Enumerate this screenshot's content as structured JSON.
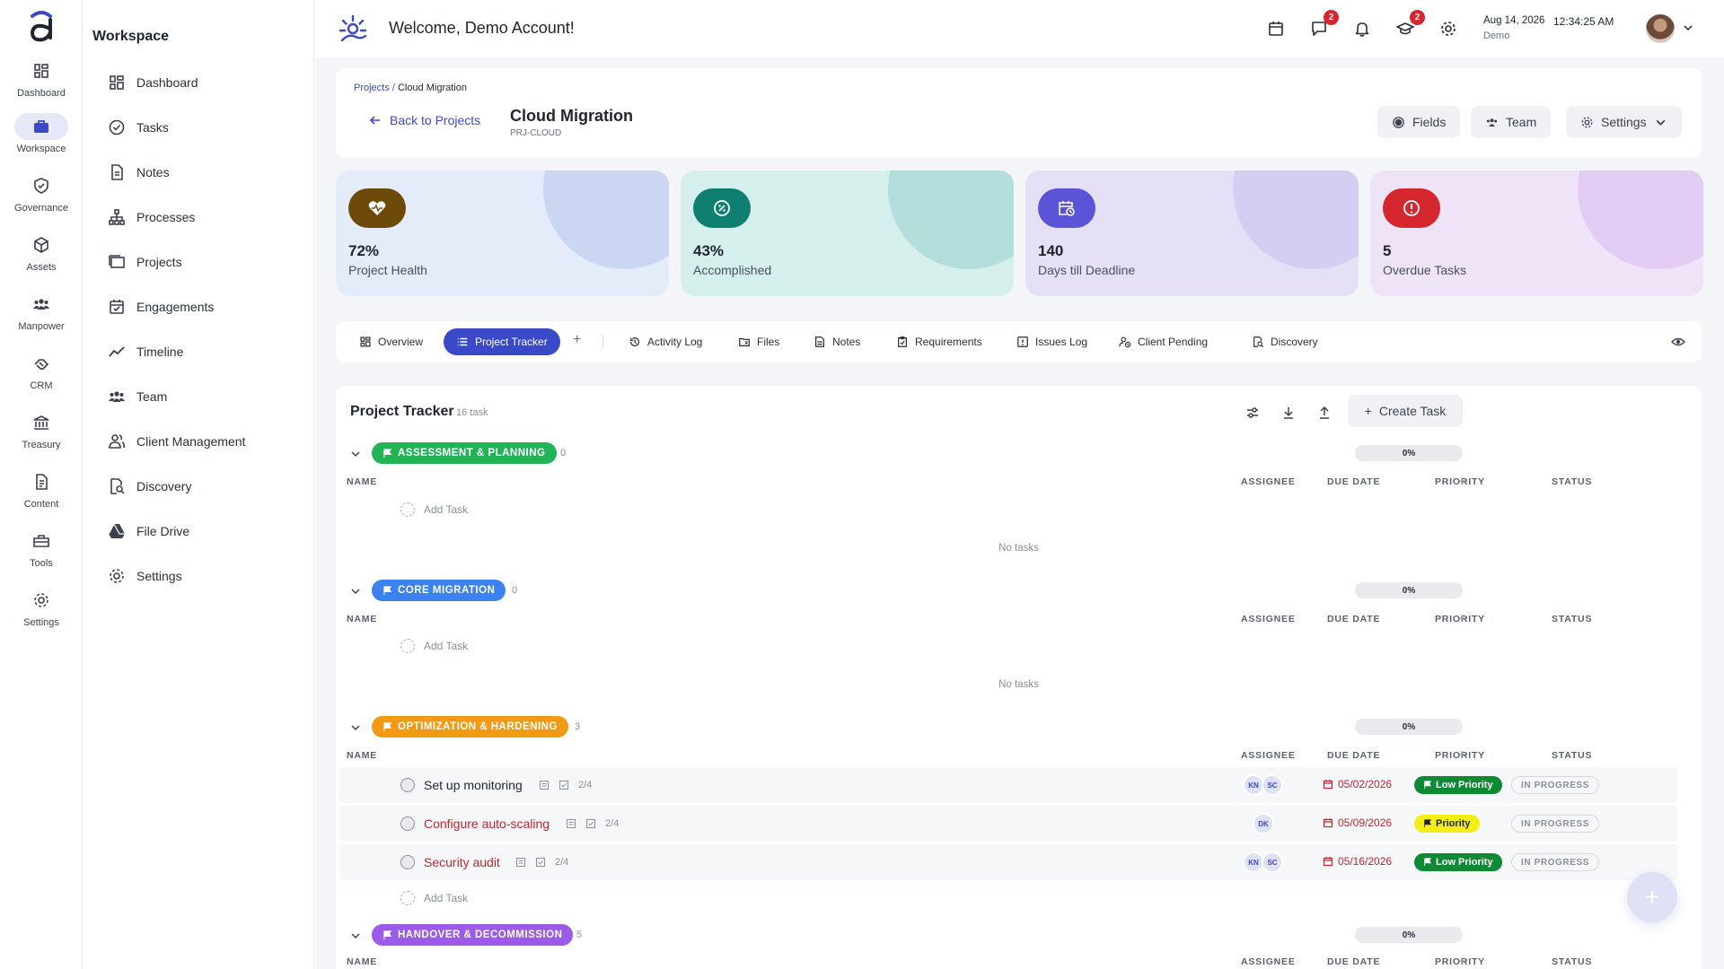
{
  "rail": {
    "items": [
      {
        "label": "Dashboard",
        "icon": "dashboard-icon"
      },
      {
        "label": "Workspace",
        "icon": "briefcase-icon",
        "active": true
      },
      {
        "label": "Governance",
        "icon": "shield-icon"
      },
      {
        "label": "Assets",
        "icon": "cube-icon"
      },
      {
        "label": "Manpower",
        "icon": "people-icon"
      },
      {
        "label": "CRM",
        "icon": "handshake-icon"
      },
      {
        "label": "Treasury",
        "icon": "bank-icon"
      },
      {
        "label": "Content",
        "icon": "document-icon"
      },
      {
        "label": "Tools",
        "icon": "toolbox-icon"
      },
      {
        "label": "Settings",
        "icon": "gear-icon"
      }
    ]
  },
  "sidebar": {
    "title": "Workspace",
    "items": [
      {
        "label": "Dashboard",
        "icon": "dashboard-icon"
      },
      {
        "label": "Tasks",
        "icon": "check-circle-icon"
      },
      {
        "label": "Notes",
        "icon": "note-icon"
      },
      {
        "label": "Processes",
        "icon": "hierarchy-icon"
      },
      {
        "label": "Projects",
        "icon": "folders-icon"
      },
      {
        "label": "Engagements",
        "icon": "calendar-check-icon"
      },
      {
        "label": "Timeline",
        "icon": "trend-icon"
      },
      {
        "label": "Team",
        "icon": "team-icon"
      },
      {
        "label": "Client Management",
        "icon": "clients-icon"
      },
      {
        "label": "Discovery",
        "icon": "discovery-icon"
      },
      {
        "label": "File Drive",
        "icon": "drive-icon"
      },
      {
        "label": "Settings",
        "icon": "gear-icon"
      }
    ]
  },
  "topbar": {
    "welcome": "Welcome, Demo Account!",
    "chat_badge": "2",
    "learn_badge": "2",
    "date": "Aug 14, 2026",
    "time": "12:34:25 AM",
    "user": "Demo"
  },
  "header": {
    "breadcrumb_root": "Projects",
    "breadcrumb_sep": "/",
    "breadcrumb_current": "Cloud Migration",
    "back_label": "Back to Projects",
    "title": "Cloud Migration",
    "code": "PRJ-CLOUD",
    "fields_label": "Fields",
    "team_label": "Team",
    "settings_label": "Settings"
  },
  "kpis": [
    {
      "value": "72%",
      "label": "Project Health",
      "bg": "#e3ecf8",
      "icon_bg": "#6e4a0a",
      "blob": "#cbd6f3"
    },
    {
      "value": "43%",
      "label": "Accomplished",
      "bg": "#d4efec",
      "icon_bg": "#0f7f72",
      "blob": "#b2dedc"
    },
    {
      "value": "140",
      "label": "Days till Deadline",
      "bg": "#e6e0f7",
      "icon_bg": "#5b53d8",
      "blob": "#d6cdf3"
    },
    {
      "value": "5",
      "label": "Overdue Tasks",
      "bg": "#efe3f7",
      "icon_bg": "#d6262e",
      "blob": "#e3ccf3"
    }
  ],
  "tabs": [
    {
      "label": "Overview"
    },
    {
      "label": "Project Tracker",
      "active": true
    },
    {
      "label": "Activity Log"
    },
    {
      "label": "Files"
    },
    {
      "label": "Notes"
    },
    {
      "label": "Requirements"
    },
    {
      "label": "Issues Log"
    },
    {
      "label": "Client Pending"
    },
    {
      "label": "Discovery"
    }
  ],
  "tab_plus": "+",
  "tracker": {
    "title": "Project Tracker",
    "count": "16 task",
    "create_label": "Create Task",
    "columns": {
      "name": "NAME",
      "assignee": "ASSIGNEE",
      "due": "DUE DATE",
      "priority": "PRIORITY",
      "status": "STATUS"
    },
    "add_task": "Add Task",
    "no_tasks": "No tasks",
    "plus": "+",
    "sections": [
      {
        "name": "ASSESSMENT & PLANNING",
        "count": "0",
        "progress": "0%",
        "color": "#22b357"
      },
      {
        "name": "CORE MIGRATION",
        "count": "0",
        "progress": "0%",
        "color": "#3b82f0"
      },
      {
        "name": "OPTIMIZATION & HARDENING",
        "count": "3",
        "progress": "0%",
        "color": "#f29a14",
        "tasks": [
          {
            "name": "Set up monitoring",
            "checklist": "2/4",
            "assignees": [
              "KN",
              "SC"
            ],
            "due": "05/02/2026",
            "priority": "Low Priority",
            "status": "IN PROGRESS",
            "name_color": "#1f2430"
          },
          {
            "name": "Configure auto-scaling",
            "checklist": "2/4",
            "assignees": [
              "DK"
            ],
            "due": "05/09/2026",
            "priority": "Priority",
            "status": "IN PROGRESS",
            "name_color": "#c3262e"
          },
          {
            "name": "Security audit",
            "checklist": "2/4",
            "assignees": [
              "KN",
              "SC"
            ],
            "due": "05/16/2026",
            "priority": "Low Priority",
            "status": "IN PROGRESS",
            "name_color": "#c3262e"
          }
        ]
      },
      {
        "name": "HANDOVER & DECOMMISSION",
        "count": "5",
        "progress": "0%",
        "color": "#9b5be8"
      }
    ]
  },
  "fab": "+"
}
